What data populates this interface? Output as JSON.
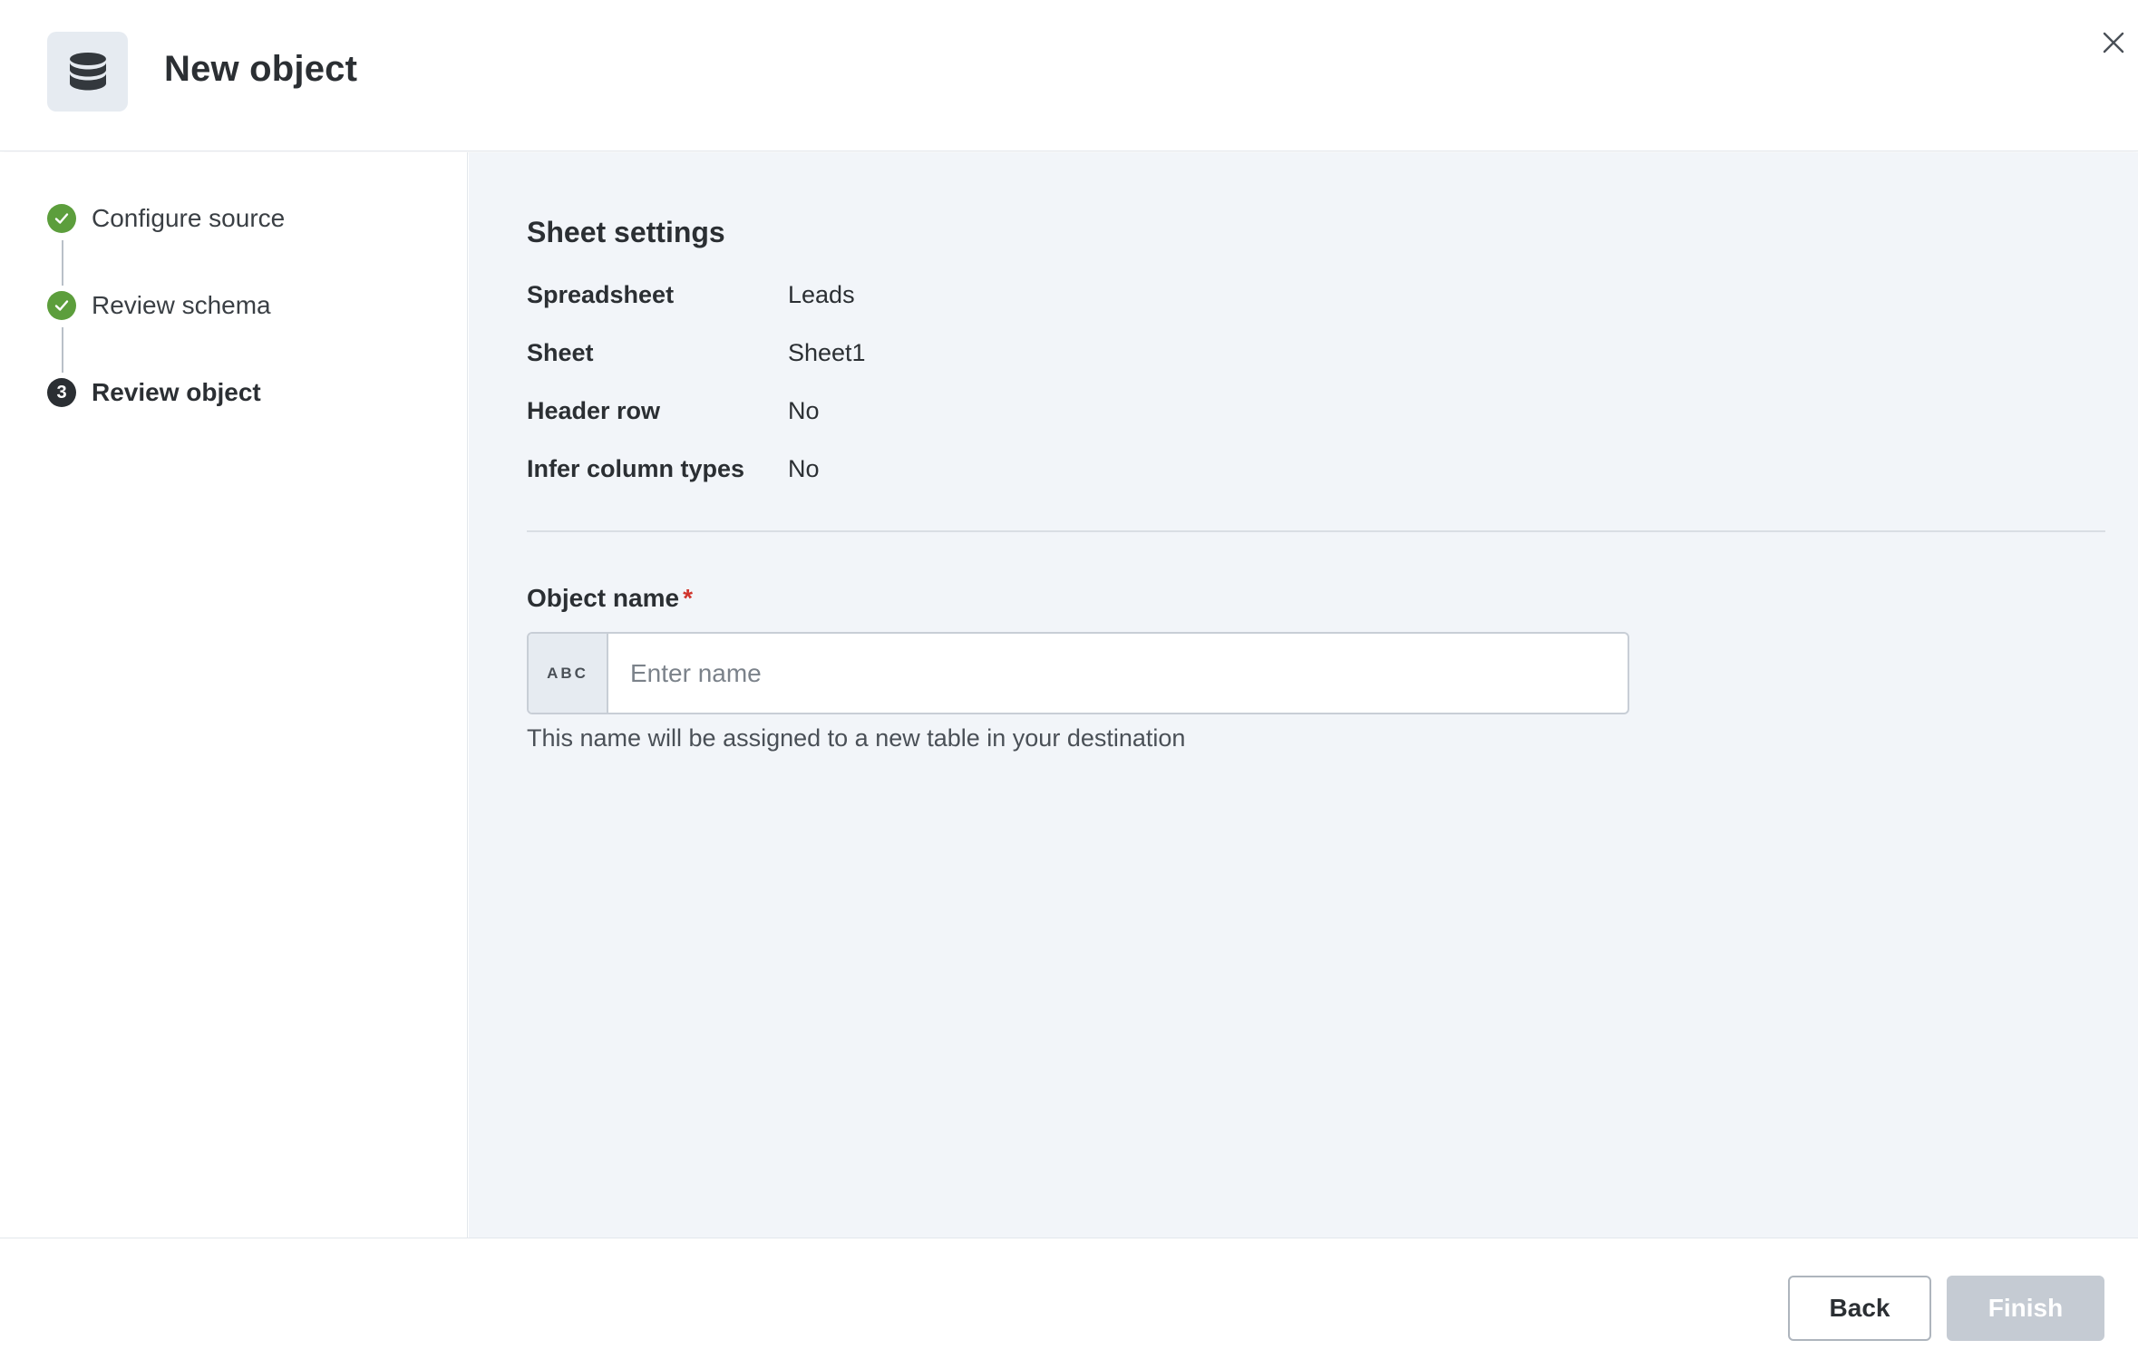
{
  "header": {
    "title": "New object",
    "icon": "database-icon"
  },
  "steps": [
    {
      "label": "Configure source",
      "status": "complete"
    },
    {
      "label": "Review schema",
      "status": "complete"
    },
    {
      "label": "Review object",
      "status": "current",
      "number": "3"
    }
  ],
  "sheet_settings": {
    "title": "Sheet settings",
    "rows": [
      {
        "key": "Spreadsheet",
        "value": "Leads"
      },
      {
        "key": "Sheet",
        "value": "Sheet1"
      },
      {
        "key": "Header row",
        "value": "No"
      },
      {
        "key": "Infer column types",
        "value": "No"
      }
    ]
  },
  "object_name": {
    "label": "Object name",
    "required_mark": "*",
    "prefix": "ABC",
    "value": "",
    "placeholder": "Enter name",
    "help": "This name will be assigned to a new table in your destination"
  },
  "footer": {
    "back_label": "Back",
    "finish_label": "Finish"
  },
  "colors": {
    "step_complete": "#5c9e3c",
    "required": "#d0342c",
    "finish_disabled": "#c5cbd3"
  }
}
